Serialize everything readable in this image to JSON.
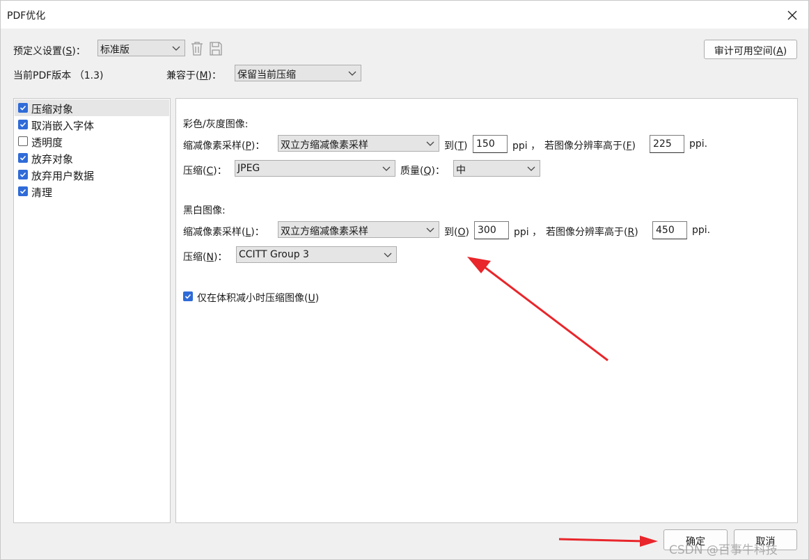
{
  "dialog": {
    "title": "PDF优化"
  },
  "preset": {
    "label": "预定义设置",
    "hotkey": "S",
    "value": "标准版",
    "audit_label": "审计可用空间",
    "audit_hotkey": "A"
  },
  "version": {
    "label": "当前PDF版本 （",
    "value": "1.3",
    "suffix": ")"
  },
  "compat": {
    "label": "兼容于",
    "hotkey": "M",
    "value": "保留当前压缩"
  },
  "sidebar": {
    "items": [
      {
        "label": "压缩对象",
        "checked": true,
        "selected": true
      },
      {
        "label": "取消嵌入字体",
        "checked": true,
        "selected": false
      },
      {
        "label": "透明度",
        "checked": false,
        "selected": false
      },
      {
        "label": "放弃对象",
        "checked": true,
        "selected": false
      },
      {
        "label": "放弃用户数据",
        "checked": true,
        "selected": false
      },
      {
        "label": "清理",
        "checked": true,
        "selected": false
      }
    ]
  },
  "color": {
    "heading": "彩色/灰度图像:",
    "downsample_label": "缩减像素采样",
    "downsample_hotkey": "P",
    "downsample_value": "双立方缩减像素采样",
    "to_label": "到",
    "to_hotkey": "T",
    "to_value": "150",
    "ppi1": "ppi ，",
    "if_label": "若图像分辨率高于",
    "if_hotkey": "F",
    "if_value": "225",
    "ppi2": "ppi.",
    "compress_label": "压缩",
    "compress_hotkey": "C",
    "compress_value": "JPEG",
    "quality_label": "质量",
    "quality_hotkey": "Q",
    "quality_value": "中"
  },
  "mono": {
    "heading": "黑白图像:",
    "downsample_label": "缩减像素采样",
    "downsample_hotkey": "L",
    "downsample_value": "双立方缩减像素采样",
    "to_label": "到",
    "to_hotkey": "O",
    "to_value": "300",
    "ppi1": "ppi ，",
    "if_label": "若图像分辨率高于",
    "if_hotkey": "R",
    "if_value": "450",
    "ppi2": "ppi.",
    "compress_label": "压缩",
    "compress_hotkey": "N",
    "compress_value": "CCITT Group 3"
  },
  "reduce_only": {
    "label": "仅在体积减小时压缩图像",
    "hotkey": "U",
    "checked": true
  },
  "footer": {
    "ok_label": "确定",
    "cancel_label": "取消"
  },
  "watermark": "CSDN @百事牛科技",
  "colors": {
    "checkbox": "#2f6bd8",
    "annotation_arrow": "#e8262b"
  },
  "icons": {
    "close": "close-icon",
    "delete": "trash-icon",
    "save": "save-icon",
    "dropdown": "chevron-down-icon",
    "check": "check-icon"
  }
}
